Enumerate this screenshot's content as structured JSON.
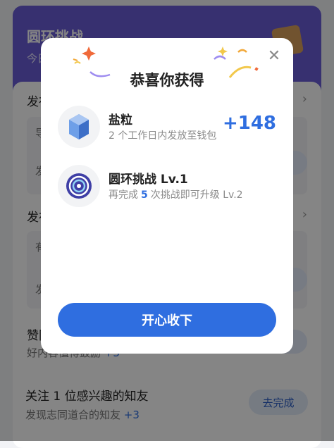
{
  "background": {
    "header_title": "圆环挑战",
    "header_sub": "今日",
    "section1_title": "发布",
    "section1_inner_a": "导",
    "section1_inner_b": "发",
    "section2_title": "发布",
    "section2_inner_a": "有",
    "section2_inner_b": "发",
    "section3_title": "赞同",
    "section3_desc": "好内容值得鼓励",
    "section3_plus": "+3",
    "task": {
      "title": "关注 1 位感兴趣的知友",
      "desc": "发现志同道合的知友",
      "plus": "+3",
      "button": "去完成"
    }
  },
  "modal": {
    "title": "恭喜你获得",
    "close_icon": "close-icon",
    "rewards": [
      {
        "icon": "salt-crystal-icon",
        "name": "盐粒",
        "desc": "2 个工作日内发放至钱包",
        "amount": "+148"
      },
      {
        "icon": "ring-challenge-badge-icon",
        "name": "圆环挑战 Lv.1",
        "desc_prefix": "再完成",
        "desc_num": "5",
        "desc_suffix": "次挑战即可升级 Lv.2"
      }
    ],
    "button": "开心收下"
  },
  "colors": {
    "accent": "#2f6ee0",
    "header_purple": "#6a5dd6",
    "overlay": "rgba(0,0,0,0.48)"
  }
}
